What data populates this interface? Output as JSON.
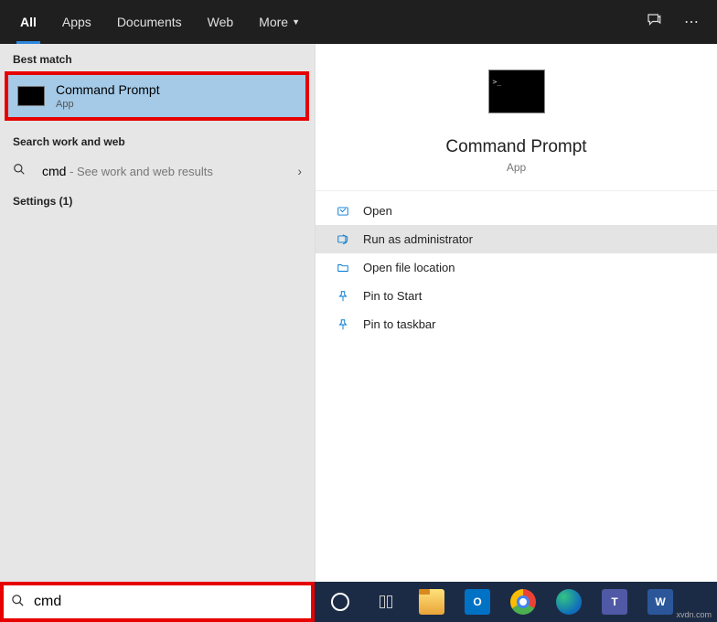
{
  "tabs": {
    "all": "All",
    "apps": "Apps",
    "documents": "Documents",
    "web": "Web",
    "more": "More"
  },
  "left": {
    "best_match_header": "Best match",
    "best_match": {
      "title": "Command Prompt",
      "sub": "App"
    },
    "search_web_header": "Search work and web",
    "search_web": {
      "query": "cmd",
      "hint": " - See work and web results"
    },
    "settings_header": "Settings (1)"
  },
  "detail": {
    "title": "Command Prompt",
    "sub": "App",
    "actions": {
      "open": "Open",
      "admin": "Run as administrator",
      "location": "Open file location",
      "pin_start": "Pin to Start",
      "pin_taskbar": "Pin to taskbar"
    }
  },
  "search": {
    "value": "cmd",
    "placeholder": ""
  },
  "taskbar": {
    "outlook": "O",
    "teams": "T",
    "word": "W"
  },
  "watermark": "xvdn.com"
}
